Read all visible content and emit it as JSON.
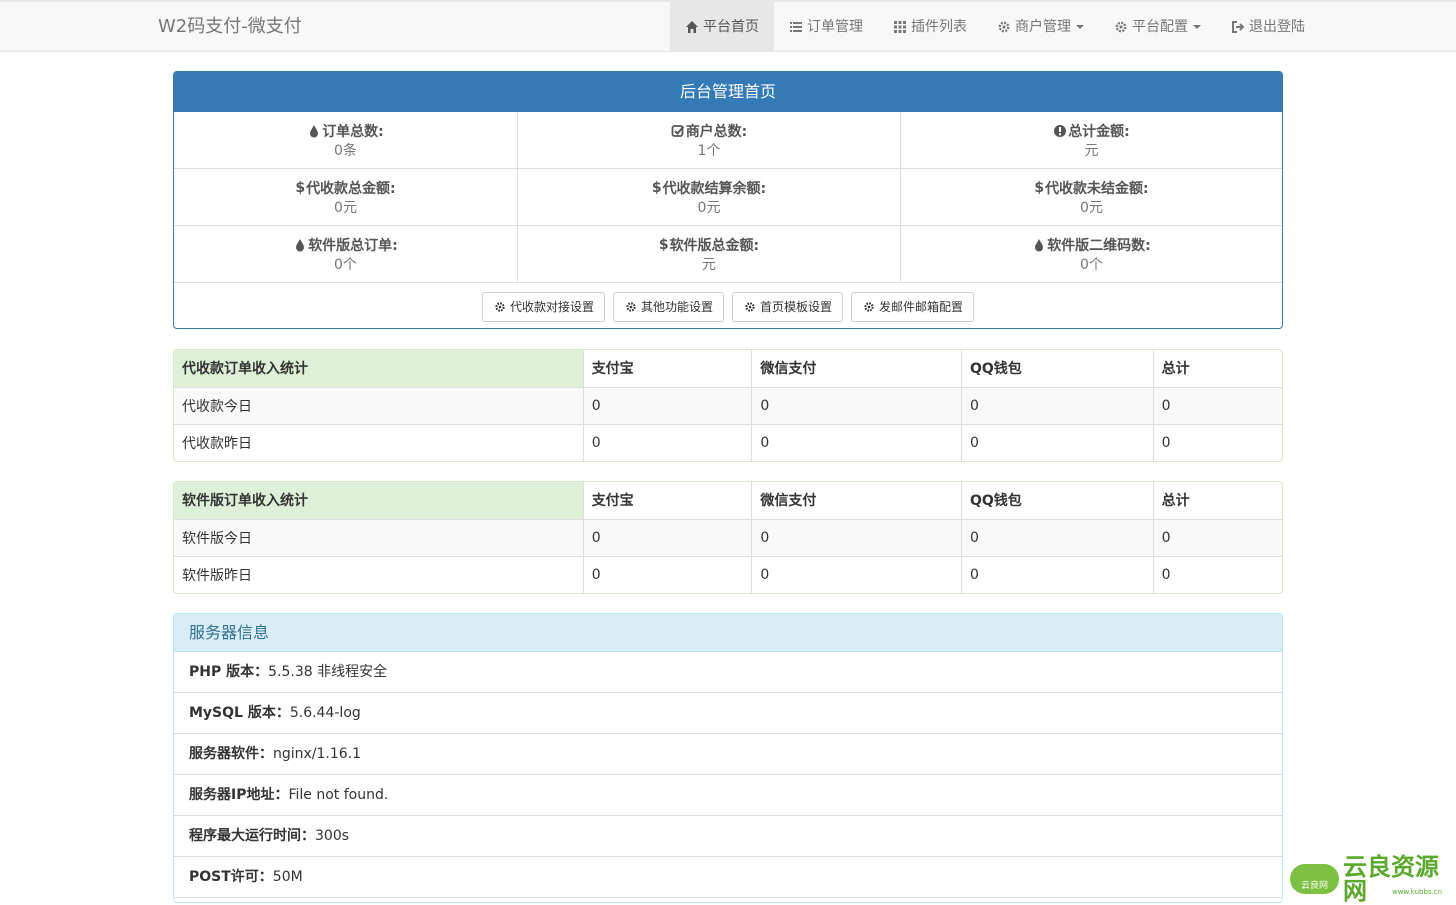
{
  "brand": "W2码支付-微支付",
  "nav": [
    {
      "label": "平台首页",
      "icon": "home-icon",
      "active": true
    },
    {
      "label": "订单管理",
      "icon": "list-icon"
    },
    {
      "label": "插件列表",
      "icon": "grid-icon"
    },
    {
      "label": "商户管理",
      "icon": "gear-icon",
      "dropdown": true
    },
    {
      "label": "平台配置",
      "icon": "gear-icon",
      "dropdown": true
    },
    {
      "label": "退出登陆",
      "icon": "logout-icon"
    }
  ],
  "dashboard": {
    "title": "后台管理首页",
    "stats": [
      {
        "label": "订单总数:",
        "value": "0条",
        "icon": "tint-icon"
      },
      {
        "label": "商户总数:",
        "value": "1个",
        "icon": "check-square-icon"
      },
      {
        "label": "总计金额:",
        "value": "元",
        "icon": "exclamation-circle-icon"
      },
      {
        "label": "代收款总金额:",
        "value": "0元",
        "icon": "dollar-icon"
      },
      {
        "label": "代收款结算余额:",
        "value": "0元",
        "icon": "dollar-icon"
      },
      {
        "label": "代收款未结金额:",
        "value": "0元",
        "icon": "dollar-icon"
      },
      {
        "label": "软件版总订单:",
        "value": "0个",
        "icon": "tint-icon"
      },
      {
        "label": "软件版总金额:",
        "value": "元",
        "icon": "dollar-icon"
      },
      {
        "label": "软件版二维码数:",
        "value": "0个",
        "icon": "tint-icon"
      }
    ],
    "buttons": [
      "代收款对接设置",
      "其他功能设置",
      "首页模板设置",
      "发邮件邮箱配置"
    ]
  },
  "table1": {
    "headers": [
      "代收款订单收入统计",
      "支付宝",
      "微信支付",
      "QQ钱包",
      "总计"
    ],
    "rows": [
      [
        "代收款今日",
        "0",
        "0",
        "0",
        "0"
      ],
      [
        "代收款昨日",
        "0",
        "0",
        "0",
        "0"
      ]
    ]
  },
  "table2": {
    "headers": [
      "软件版订单收入统计",
      "支付宝",
      "微信支付",
      "QQ钱包",
      "总计"
    ],
    "rows": [
      [
        "软件版今日",
        "0",
        "0",
        "0",
        "0"
      ],
      [
        "软件版昨日",
        "0",
        "0",
        "0",
        "0"
      ]
    ]
  },
  "server": {
    "title": "服务器信息",
    "rows": [
      {
        "label": "PHP 版本：",
        "value": "5.5.38 非线程安全"
      },
      {
        "label": "MySQL 版本：",
        "value": "5.6.44-log"
      },
      {
        "label": "服务器软件：",
        "value": "nginx/1.16.1"
      },
      {
        "label": "服务器IP地址：",
        "value": "File not found."
      },
      {
        "label": "程序最大运行时间：",
        "value": "300s"
      },
      {
        "label": "POST许可：",
        "value": "50M"
      }
    ]
  },
  "watermark": {
    "text": "云良资源网",
    "cloud_text": "云良网",
    "sub": "www.kubbs.cn"
  }
}
